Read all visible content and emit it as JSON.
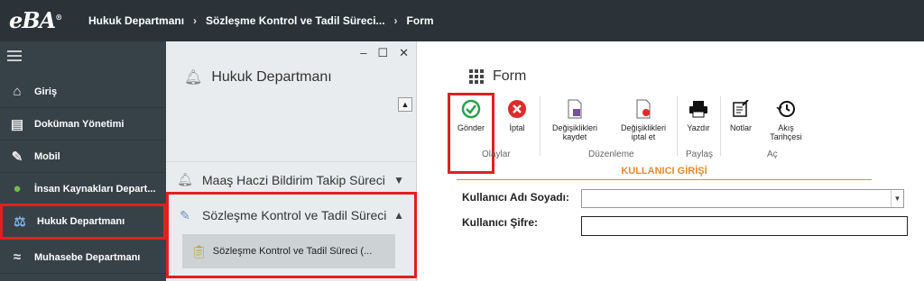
{
  "app": {
    "logo": "eBA",
    "breadcrumbs": [
      "Hukuk Departmanı",
      "Sözleşme Kontrol ve Tadil Süreci...",
      "Form"
    ]
  },
  "leftnav": {
    "items": [
      {
        "label": "Giriş",
        "icon": "home-icon"
      },
      {
        "label": "Doküman Yönetimi",
        "icon": "documents-icon"
      },
      {
        "label": "Mobil",
        "icon": "mobile-icon"
      },
      {
        "label": "İnsan Kaynakları Depart...",
        "icon": "people-icon"
      },
      {
        "label": "Hukuk Departmanı",
        "icon": "law-icon"
      },
      {
        "label": "Muhasebe Departmanı",
        "icon": "chart-icon"
      }
    ]
  },
  "midpanel": {
    "title": "Hukuk Departmanı",
    "items": [
      {
        "label": "Maaş Haczi Bildirim Takip Süreci"
      },
      {
        "label": "Sözleşme Kontrol ve Tadil Süreci"
      }
    ],
    "subitem": "Sözleşme Kontrol ve Tadil Süreci (..."
  },
  "form": {
    "title": "Form",
    "toolbar": {
      "send": "Gönder",
      "cancel": "İptal",
      "save_changes": [
        "Değişiklikleri",
        "kaydet"
      ],
      "cancel_changes": [
        "Değişiklikleri",
        "iptal et"
      ],
      "print": "Yazdır",
      "notes": "Notlar",
      "history": [
        "Akış",
        "Tarihçesi"
      ],
      "groups": {
        "actions": "Olaylar",
        "edit": "Düzenleme",
        "share": "Paylaş",
        "open": "Aç"
      }
    },
    "section_title": "KULLANICI GİRİŞİ",
    "fields": {
      "username_label": "Kullanıcı Adı Soyadı:",
      "password_label": "Kullanıcı Şifre:"
    }
  },
  "colors": {
    "highlight": "#e0201f",
    "accent": "#e08c2a",
    "topbar": "#2b3338",
    "nav": "#374248"
  }
}
